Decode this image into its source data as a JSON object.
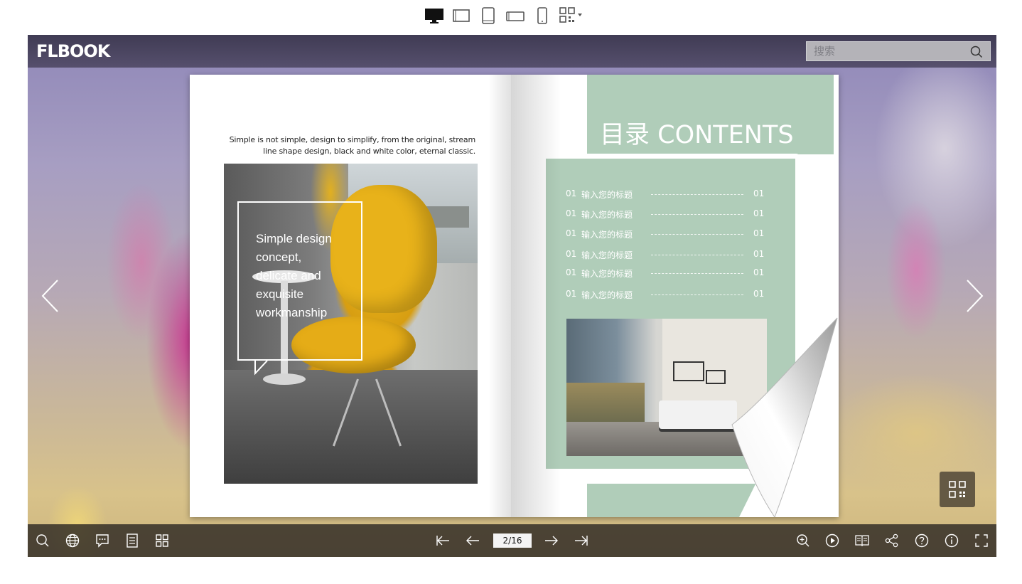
{
  "device_bar": {
    "devices": [
      "desktop-icon",
      "tablet-landscape-icon",
      "tablet-portrait-icon",
      "phone-landscape-icon",
      "phone-portrait-icon",
      "qr-code-icon"
    ]
  },
  "header": {
    "logo_text": "FLBOOK",
    "search_placeholder": "搜索"
  },
  "book": {
    "left_page": {
      "intro_text": "Simple is not simple, design to simplify, from the original, stream line shape design, black and white color, eternal classic.",
      "callout_lines": [
        "Simple design",
        "concept,",
        "delicate and",
        "exquisite",
        "workmanship"
      ]
    },
    "right_page": {
      "contents_title": "目录 CONTENTS",
      "toc": [
        {
          "num": "01",
          "title": "输入您的标题",
          "page": "01"
        },
        {
          "num": "01",
          "title": "输入您的标题",
          "page": "01"
        },
        {
          "num": "01",
          "title": "输入您的标题",
          "page": "01"
        },
        {
          "num": "01",
          "title": "输入您的标题",
          "page": "01"
        },
        {
          "num": "01",
          "title": "输入您的标题",
          "page": "01"
        },
        {
          "num": "01",
          "title": "输入您的标题",
          "page": "01"
        }
      ]
    }
  },
  "toolbar": {
    "page_indicator": "2/16"
  },
  "colors": {
    "toc_green": "#b0cdb9",
    "toolbar_bg": "#2d2823",
    "header_bg": "#3a354b"
  }
}
